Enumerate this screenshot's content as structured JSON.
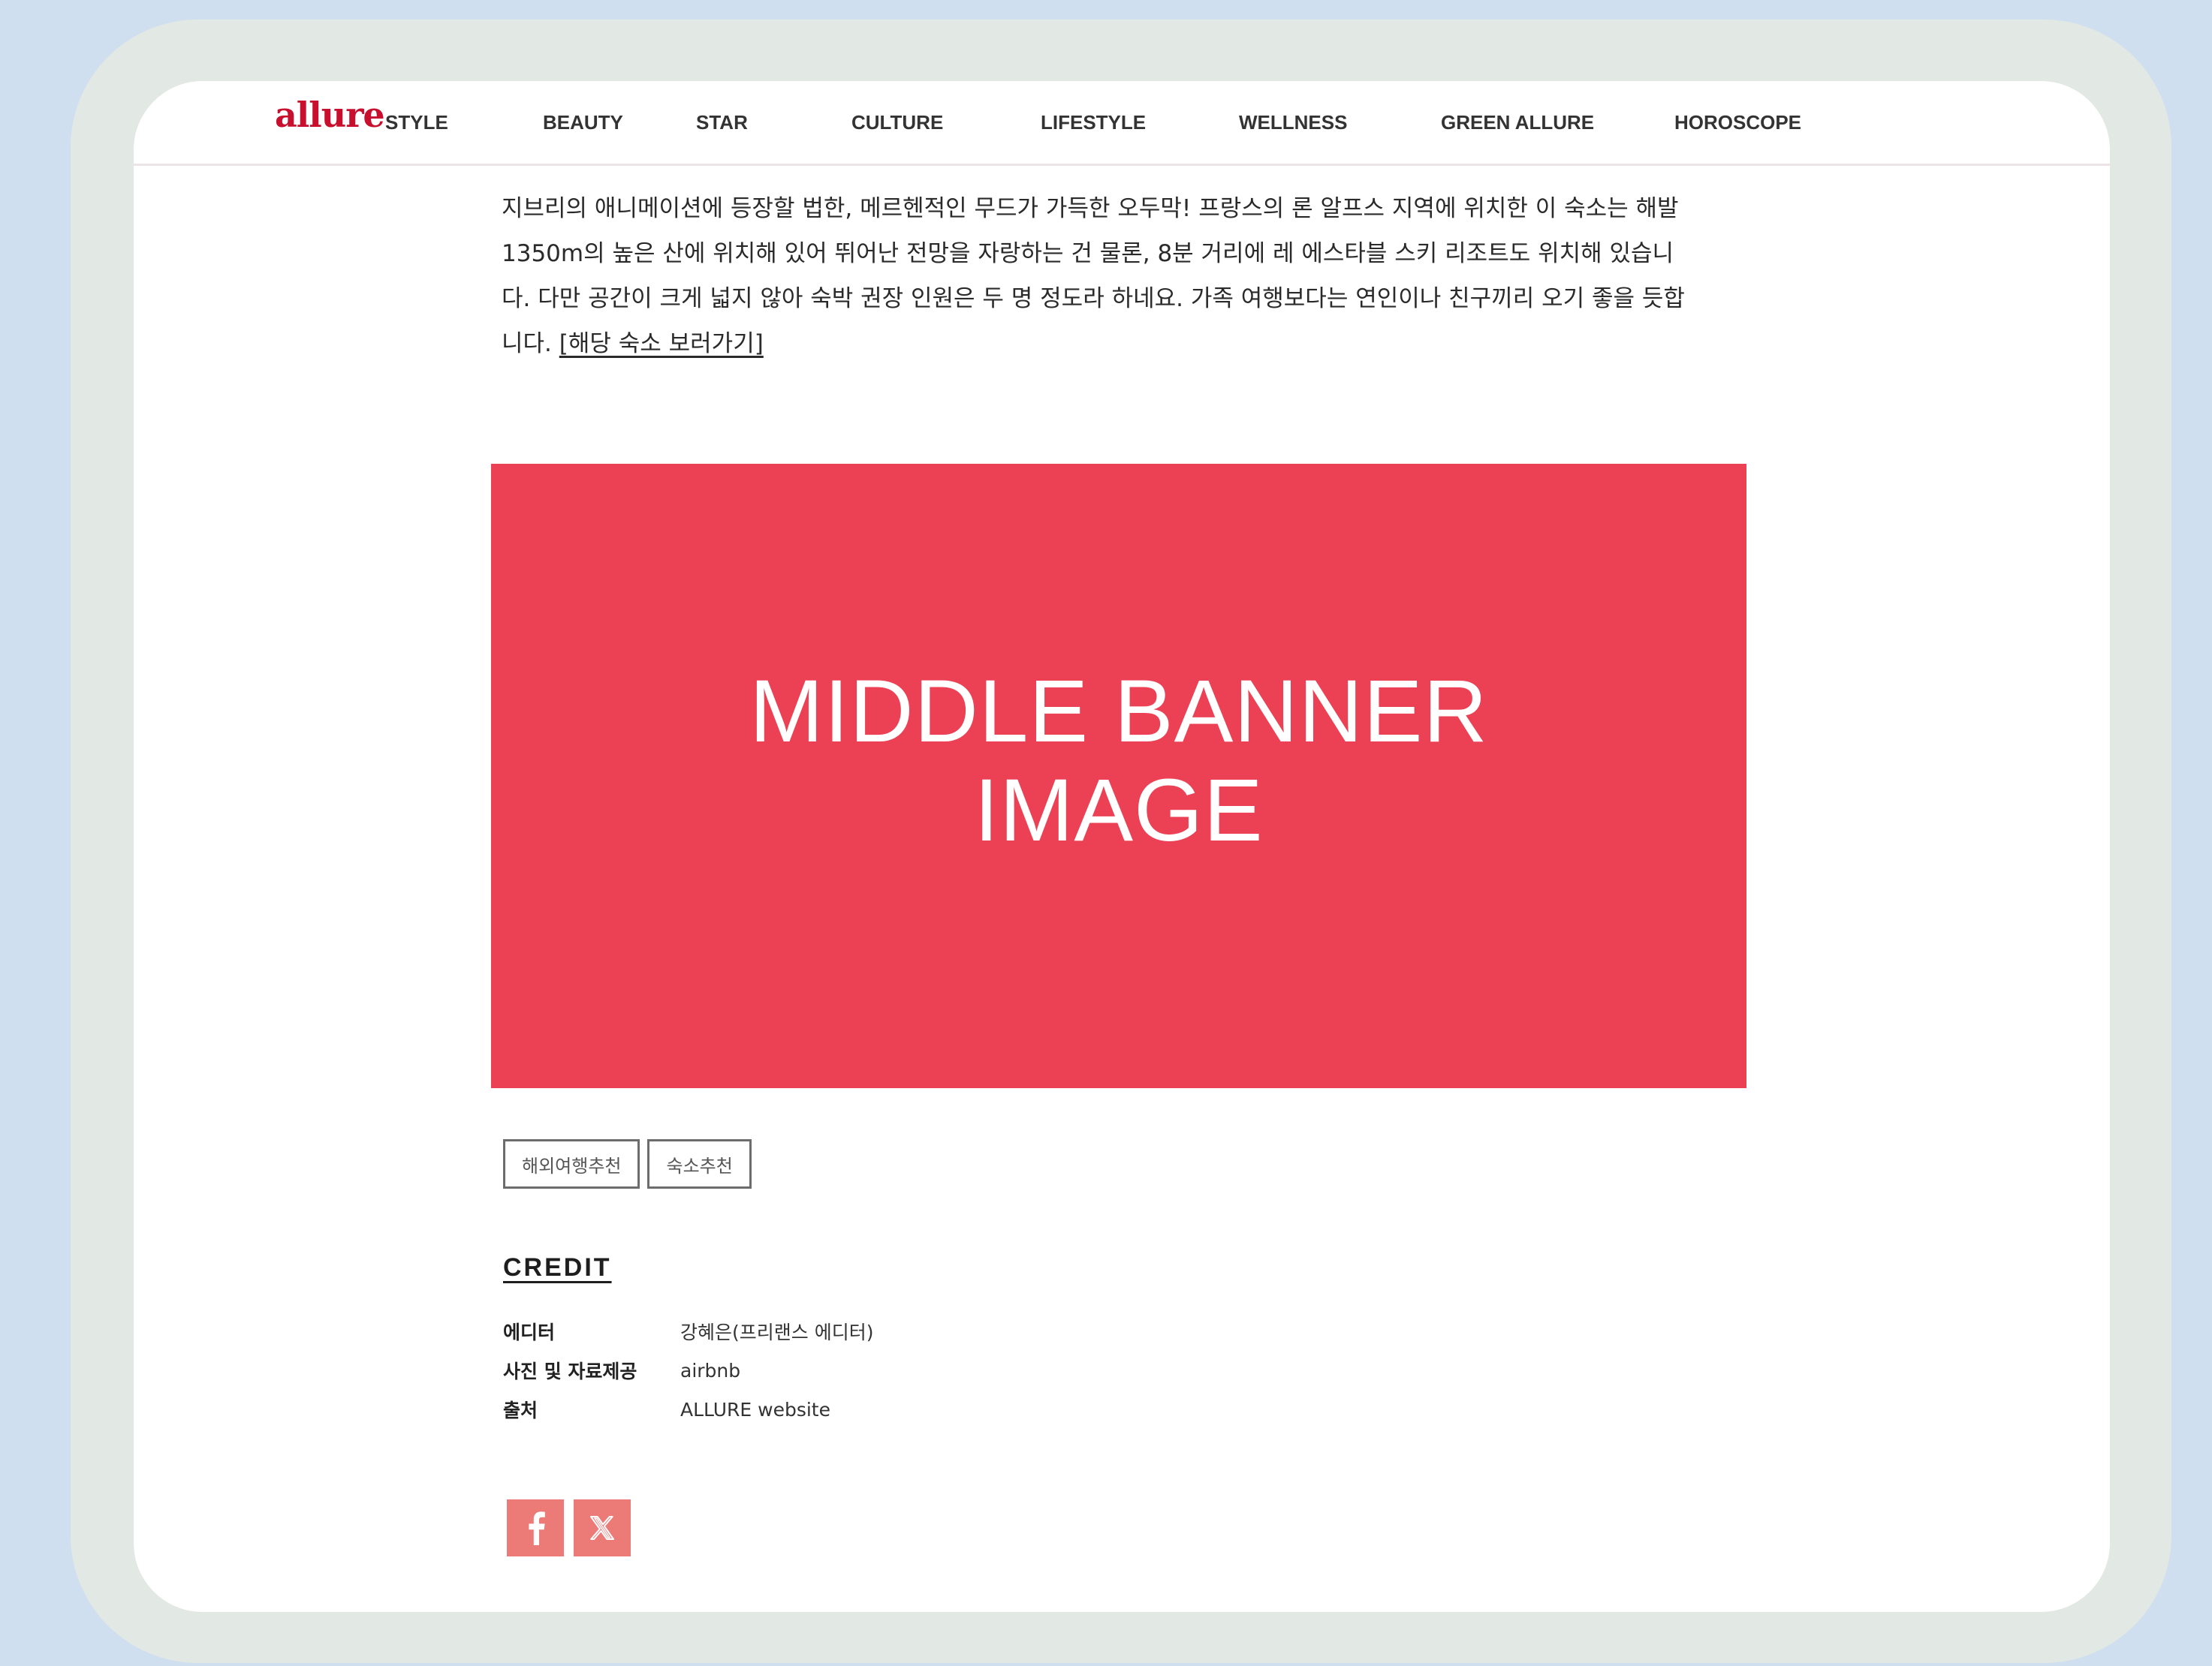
{
  "site": {
    "logo": "allure",
    "brand_color": "#c8102e"
  },
  "nav": {
    "items": [
      {
        "label": "STYLE"
      },
      {
        "label": "BEAUTY"
      },
      {
        "label": "STAR"
      },
      {
        "label": "CULTURE"
      },
      {
        "label": "LIFESTYLE"
      },
      {
        "label": "WELLNESS"
      },
      {
        "label": "GREEN ALLURE"
      },
      {
        "label": "HOROSCOPE"
      }
    ]
  },
  "article": {
    "paragraph": "지브리의 애니메이션에 등장할 법한, 메르헨적인 무드가 가득한 오두막! 프랑스의 론 알프스 지역에 위치한 이 숙소는 해발 1350m의 높은 산에 위치해 있어 뛰어난 전망을 자랑하는 건 물론, 8분 거리에 레 에스타블 스키 리조트도 위치해 있습니다. 다만 공간이 크게 넓지 않아 숙박 권장 인원은 두 명 정도라 하네요. 가족 여행보다는 연인이나 친구끼리 오기 좋을 듯합니다. ",
    "link_text": "[해당 숙소 보러가기]"
  },
  "banner": {
    "text": "MIDDLE BANNER\nIMAGE",
    "color": "#ec4154"
  },
  "tags": [
    {
      "label": "해외여행추천"
    },
    {
      "label": "숙소추천"
    }
  ],
  "credit": {
    "title": "CREDIT",
    "rows": [
      {
        "label": "에디터",
        "value": "강혜은(프리랜스 에디터)"
      },
      {
        "label": "사진 및 자료제공",
        "value": "airbnb"
      },
      {
        "label": "출처",
        "value": "ALLURE website"
      }
    ]
  },
  "social": {
    "color": "#ec7b78",
    "icons": [
      "facebook-icon",
      "x-icon"
    ]
  }
}
